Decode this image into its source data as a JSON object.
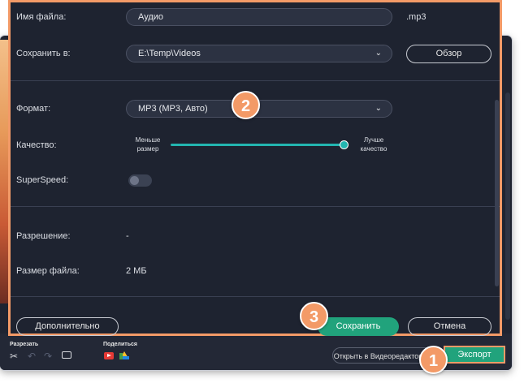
{
  "dialog": {
    "filename": {
      "label": "Имя файла:",
      "value": "Аудио",
      "extension": ".mp3"
    },
    "save_to": {
      "label": "Сохранить в:",
      "value": "E:\\Temp\\Videos",
      "browse_label": "Обзор"
    },
    "format": {
      "label": "Формат:",
      "value": "MP3 (MP3, Авто)"
    },
    "quality": {
      "label": "Качество:",
      "min_label": "Меньше размер",
      "max_label": "Лучше качество",
      "level": 1.0
    },
    "superspeed": {
      "label": "SuperSpeed:",
      "enabled": false
    },
    "resolution": {
      "label": "Разрешение:",
      "value": "-"
    },
    "filesize": {
      "label": "Размер файла:",
      "value": "2 МБ"
    },
    "advanced_label": "Дополнительно",
    "save_label": "Сохранить",
    "cancel_label": "Отмена"
  },
  "toolbar": {
    "cut_label": "Разрезать",
    "share_label": "Поделиться",
    "open_in_editor_label": "Открыть в Видеоредакторе",
    "export_label": "Экспорт"
  },
  "callouts": {
    "one": "1",
    "two": "2",
    "three": "3"
  },
  "icons": [
    "scissors-icon",
    "undo-icon",
    "redo-icon",
    "camera-icon",
    "youtube-icon",
    "google-drive-icon",
    "chevron-down-icon"
  ],
  "colors": {
    "accent_green": "#21a37c",
    "callout_orange": "#f39a67",
    "slider_teal": "#23b5b0",
    "dialog_bg": "#1e2330"
  }
}
